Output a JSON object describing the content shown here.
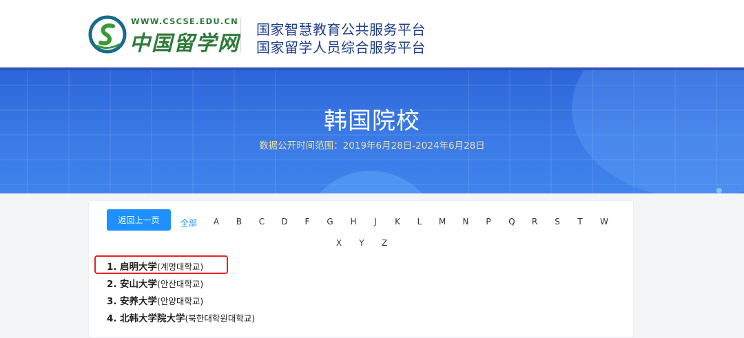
{
  "header": {
    "logo_url": "WWW.CSCSE.EDU.CN",
    "logo_name": "中国留学网",
    "platform_line1": "国家智慧教育公共服务平台",
    "platform_line2": "国家留学人员综合服务平台"
  },
  "banner": {
    "title": "韩国院校",
    "subtitle": "数据公开时间范围：2019年6月28日-2024年6月28日"
  },
  "nav": {
    "back_label": "返回上一页",
    "all_label": "全部",
    "letters": [
      "A",
      "B",
      "C",
      "D",
      "F",
      "G",
      "H",
      "J",
      "K",
      "L",
      "M",
      "N",
      "P",
      "Q",
      "R",
      "S",
      "T",
      "W",
      "X",
      "Y",
      "Z"
    ]
  },
  "universities": [
    {
      "num": "1.",
      "name": "启明大学",
      "korean": "(계명대학교)"
    },
    {
      "num": "2.",
      "name": "安山大学",
      "korean": "(안산대학교)"
    },
    {
      "num": "3.",
      "name": "安养大学",
      "korean": "(안양대학교)"
    },
    {
      "num": "4.",
      "name": "北韩大学院大学",
      "korean": "(북한대학원대학교)"
    }
  ],
  "colors": {
    "accent": "#1e90ff",
    "header_text": "#1f3f8a",
    "logo_green": "#2f7a3a",
    "banner_blue": "#3a7ae6",
    "highlight": "#e8231f",
    "subtitle": "#f2dfa0"
  }
}
